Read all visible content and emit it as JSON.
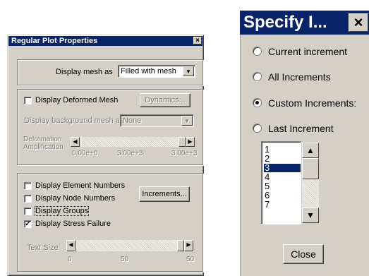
{
  "regular_plot": {
    "title": "Regular Plot Properties",
    "display_mesh_label": "Display mesh as",
    "display_mesh_value": "Filled with mesh",
    "display_deformed_mesh": "Display Deformed Mesh",
    "dynamics_button": "Dynamics...",
    "display_background_label": "Display background mesh as",
    "background_value": "None",
    "deformation_label_1": "Deformation",
    "deformation_label_2": "Amplification",
    "deform_ticks": [
      "0.00e+0",
      "3.00e+3",
      "3.00e+3"
    ],
    "deform_level": 1.0,
    "checkboxes": [
      {
        "label": "Display Element Numbers",
        "checked": false
      },
      {
        "label": "Display Node Numbers",
        "checked": false
      },
      {
        "label": "Display Groups",
        "checked": false
      },
      {
        "label": "Display Stress Failure",
        "checked": true
      }
    ],
    "increments_button": "Increments...",
    "text_size_label": "Text Size",
    "text_ticks": [
      "0",
      "50",
      "50"
    ],
    "text_size_level": 1.0
  },
  "specify": {
    "title": "Specify I...",
    "options": [
      {
        "label": "Current increment",
        "selected": false
      },
      {
        "label": "All Increments",
        "selected": false
      },
      {
        "label": "Custom Increments:",
        "selected": true
      },
      {
        "label": "Last Increment",
        "selected": false
      }
    ],
    "list_items": [
      "1",
      "2",
      "3",
      "4",
      "5",
      "6",
      "7"
    ],
    "selected_item": "3",
    "close_button": "Close"
  },
  "icons": {
    "close": "close-icon",
    "dropdown": "chevron-down-icon",
    "scroll_left": "arrow-left-icon",
    "scroll_right": "arrow-right-icon",
    "scroll_up": "arrow-up-icon",
    "scroll_down": "arrow-down-icon",
    "checkmark": "checkmark-icon"
  },
  "colors": {
    "titlebar": "#0a246a",
    "face": "#d4d0c8",
    "selection": "#0a246a"
  }
}
